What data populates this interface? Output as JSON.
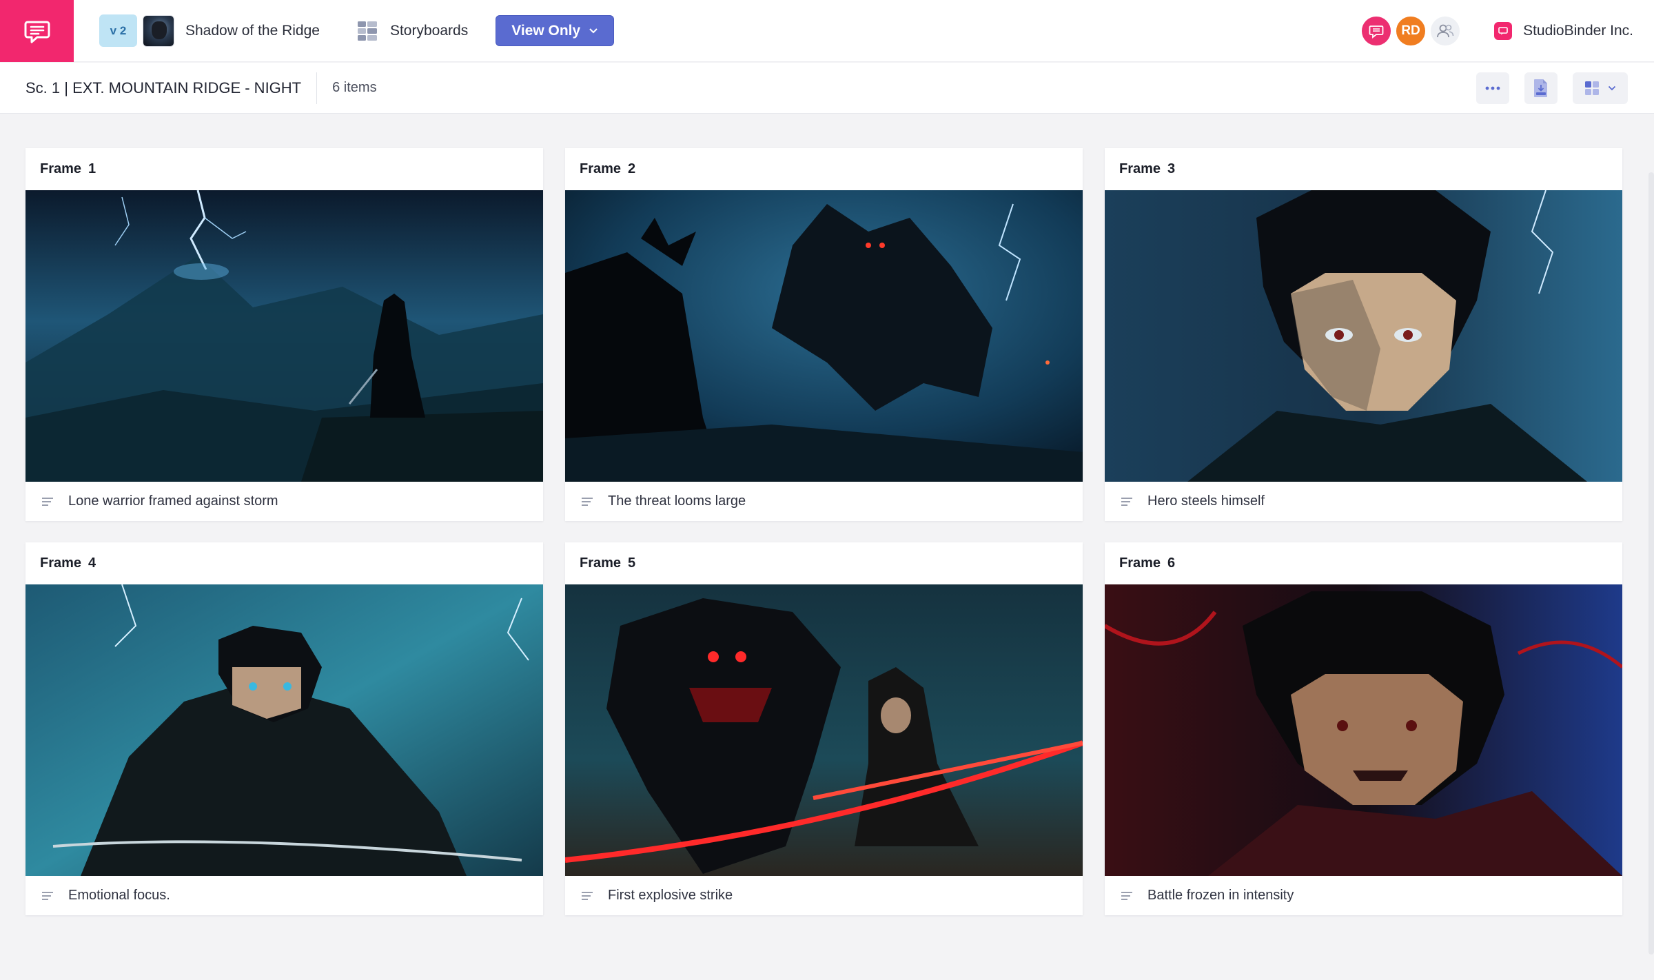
{
  "header": {
    "version": "v 2",
    "project_name": "Shadow of the Ridge",
    "section": "Storyboards",
    "view_mode": "View Only",
    "avatars": [
      {
        "kind": "comments-icon",
        "color": "#ec2f71"
      },
      {
        "initials": "RD",
        "color": "#f07d20"
      },
      {
        "kind": "people-icon",
        "color": "#eef0f4"
      }
    ],
    "org_name": "StudioBinder Inc."
  },
  "subheader": {
    "scene": "Sc. 1 | EXT. MOUNTAIN RIDGE - NIGHT",
    "count": "6 items"
  },
  "frames": [
    {
      "label": "Frame",
      "number": "1",
      "caption": "Lone warrior framed against storm"
    },
    {
      "label": "Frame",
      "number": "2",
      "caption": "The threat looms large"
    },
    {
      "label": "Frame",
      "number": "3",
      "caption": "Hero steels himself"
    },
    {
      "label": "Frame",
      "number": "4",
      "caption": "Emotional focus."
    },
    {
      "label": "Frame",
      "number": "5",
      "caption": "First explosive strike"
    },
    {
      "label": "Frame",
      "number": "6",
      "caption": "Battle frozen in intensity"
    }
  ],
  "colors": {
    "brand": "#f2276e",
    "accent": "#5a6bd0"
  }
}
